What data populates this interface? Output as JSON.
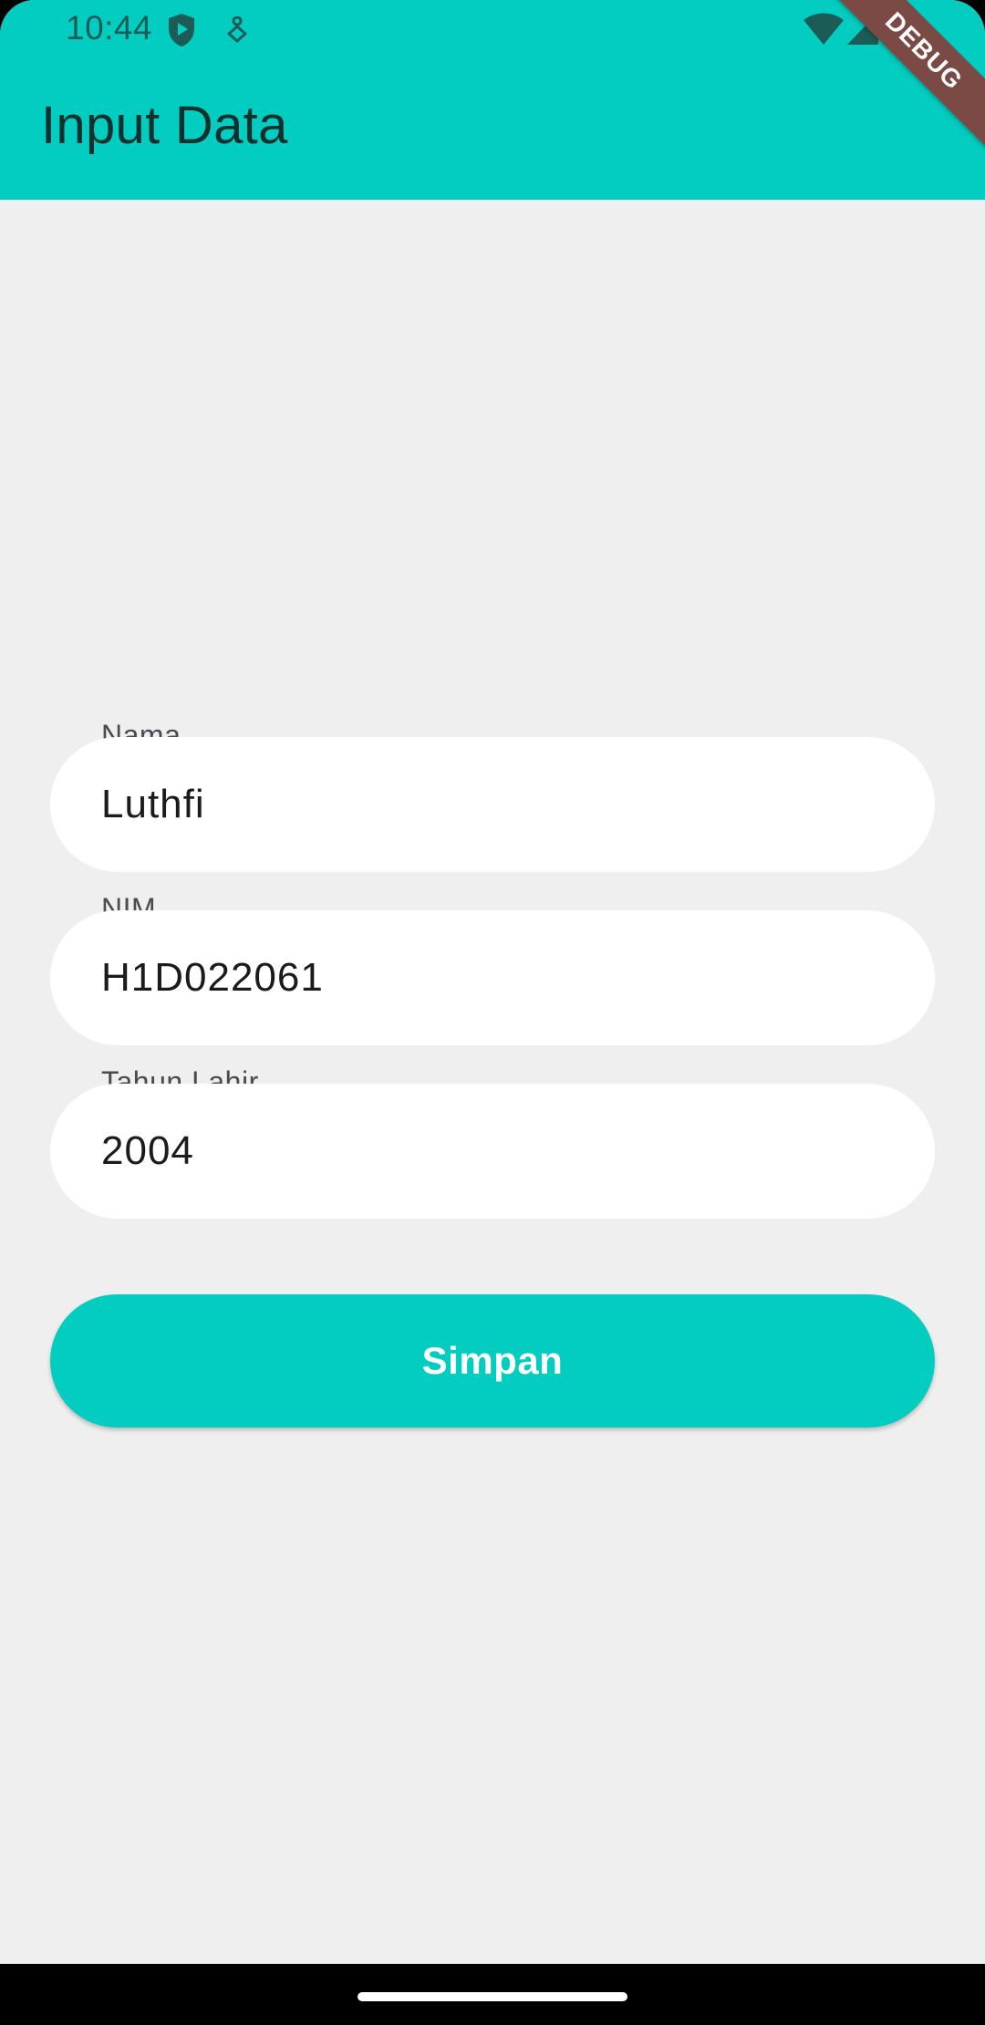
{
  "status_bar": {
    "time": "10:44",
    "icons": [
      "play-protect-icon",
      "accessibility-icon",
      "wifi-icon",
      "signal-icon",
      "battery-icon"
    ]
  },
  "app_bar": {
    "title": "Input Data",
    "color": "#03cdc1"
  },
  "debug_banner": {
    "label": "DEBUG",
    "color": "#7c4a45"
  },
  "form": {
    "fields": [
      {
        "label": "Nama",
        "value": "Luthfi"
      },
      {
        "label": "NIM",
        "value": "H1D022061"
      },
      {
        "label": "Tahun Lahir",
        "value": "2004"
      }
    ],
    "submit_label": "Simpan"
  }
}
